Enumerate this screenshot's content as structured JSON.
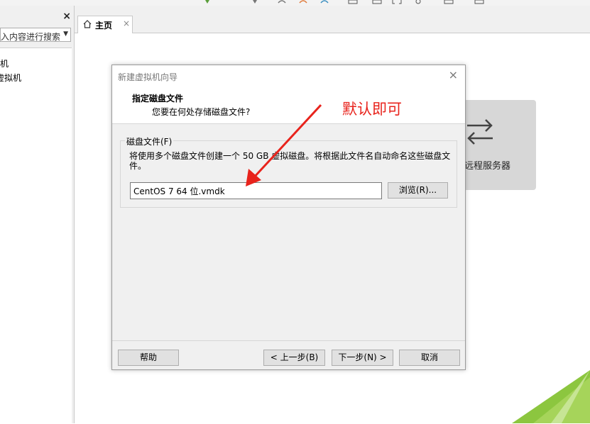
{
  "left_panel": {
    "close_glyph": "×",
    "search_placeholder": "在此处键入内容进行搜索",
    "search_visible_text": "入内容进行搜索",
    "tree": [
      {
        "label": "我的计算机",
        "visible": "机"
      },
      {
        "label": "共享的虚拟机",
        "visible": "虚拟机"
      }
    ]
  },
  "tabs": [
    {
      "label": "主页",
      "close_glyph": "×",
      "icon": "home-icon"
    }
  ],
  "home": {
    "remote_tile_label": "远程服务器",
    "remote_tile_icon": "swap-arrows-icon"
  },
  "dialog": {
    "title": "新建虚拟机向导",
    "close_glyph": "×",
    "header_title": "指定磁盘文件",
    "header_subtitle": "您要在何处存储磁盘文件?",
    "group_label": "磁盘文件(F)",
    "group_description": "将使用多个磁盘文件创建一个 50 GB 虚拟磁盘。将根据此文件名自动命名这些磁盘文件。",
    "file_value": "CentOS 7 64 位.vmdk",
    "browse_button": "浏览(R)...",
    "help_button": "帮助",
    "back_button": "< 上一步(B)",
    "next_button": "下一步(N) >",
    "cancel_button": "取消"
  },
  "annotation": {
    "text": "默认即可",
    "color": "#e8231c"
  },
  "colors": {
    "accent_green": "#8cc63f",
    "tile_gray": "#d7d7d7"
  }
}
